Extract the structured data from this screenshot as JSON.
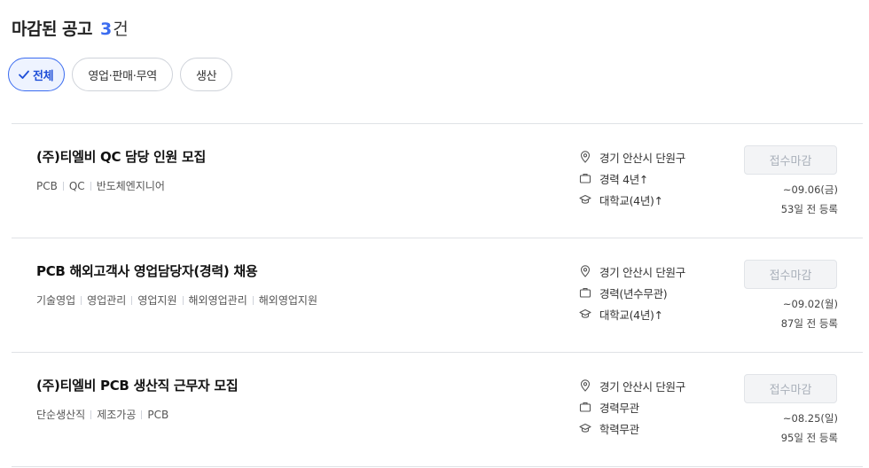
{
  "header": {
    "title": "마감된 공고",
    "count": "3",
    "unit": "건"
  },
  "filters": [
    {
      "label": "전체",
      "active": true
    },
    {
      "label": "영업·판매·무역",
      "active": false
    },
    {
      "label": "생산",
      "active": false
    }
  ],
  "jobs": [
    {
      "title": "(주)티엘비 QC 담당 인원 모집",
      "tags": [
        "PCB",
        "QC",
        "반도체엔지니어"
      ],
      "location": "경기 안산시 단원구",
      "experience": "경력 4년↑",
      "education": "대학교(4년)↑",
      "button": "접수마감",
      "deadline": "~09.06(금)",
      "posted": "53일 전 등록"
    },
    {
      "title": "PCB 해외고객사 영업담당자(경력) 채용",
      "tags": [
        "기술영업",
        "영업관리",
        "영업지원",
        "해외영업관리",
        "해외영업지원"
      ],
      "location": "경기 안산시 단원구",
      "experience": "경력(년수무관)",
      "education": "대학교(4년)↑",
      "button": "접수마감",
      "deadline": "~09.02(월)",
      "posted": "87일 전 등록"
    },
    {
      "title": "(주)티엘비 PCB 생산직 근무자 모집",
      "tags": [
        "단순생산직",
        "제조가공",
        "PCB"
      ],
      "location": "경기 안산시 단원구",
      "experience": "경력무관",
      "education": "학력무관",
      "button": "접수마감",
      "deadline": "~08.25(일)",
      "posted": "95일 전 등록"
    }
  ],
  "colors": {
    "accent": "#3b6cf0",
    "border": "#dfe2e6",
    "disabled_bg": "#f3f4f6"
  },
  "icons": {
    "location": "map-pin-icon",
    "experience": "briefcase-icon",
    "education": "graduation-cap-icon",
    "check": "check-icon"
  }
}
